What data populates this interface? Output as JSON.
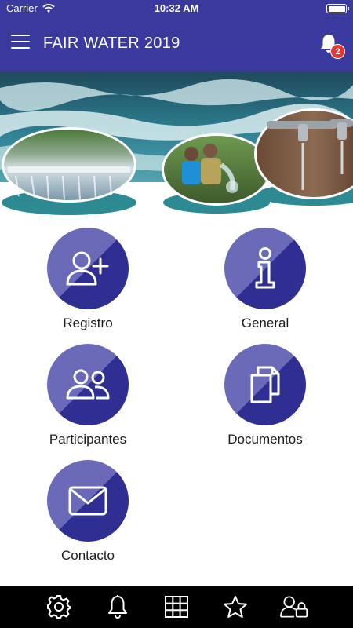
{
  "status_bar": {
    "carrier": "Carrier",
    "time": "10:32 AM"
  },
  "header": {
    "title": "FAIR WATER 2019",
    "notification_count": "2"
  },
  "banner": {
    "icon": "water-banner-image"
  },
  "menu": {
    "items": [
      {
        "label": "Registro",
        "icon": "add-user-icon"
      },
      {
        "label": "General",
        "icon": "info-icon"
      },
      {
        "label": "Participantes",
        "icon": "users-icon"
      },
      {
        "label": "Documentos",
        "icon": "documents-icon"
      },
      {
        "label": "Contacto",
        "icon": "mail-icon"
      }
    ]
  },
  "tab_bar": {
    "items": [
      "settings-icon",
      "bell-icon",
      "grid-icon",
      "star-icon",
      "user-lock-icon"
    ]
  },
  "colors": {
    "primary": "#3a3a9e",
    "circle_light": "#6a6ab8",
    "circle_dark": "#2f2f93",
    "badge": "#e53935"
  }
}
